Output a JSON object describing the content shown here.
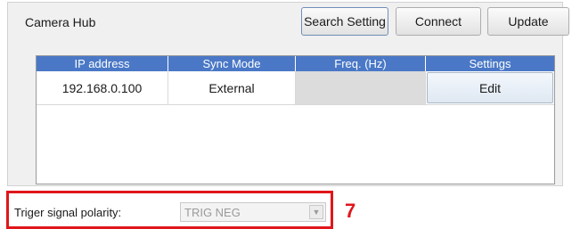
{
  "header": {
    "title": "Camera Hub",
    "search_setting_label": "Search Setting",
    "connect_label": "Connect",
    "update_label": "Update"
  },
  "table": {
    "columns": [
      "IP address",
      "Sync Mode",
      "Freq. (Hz)",
      "Settings"
    ],
    "rows": [
      {
        "ip": "192.168.0.100",
        "sync_mode": "External",
        "freq": "",
        "settings_label": "Edit"
      }
    ]
  },
  "trigger": {
    "label": "Triger signal polarity:",
    "value": "TRIG NEG",
    "arrow_icon": "dropdown-arrow-icon"
  },
  "annotation": {
    "callout": "7",
    "color": "#e0161b"
  },
  "colors": {
    "header_bg": "#4a78c6",
    "panel_bg": "#f0f0f0"
  }
}
